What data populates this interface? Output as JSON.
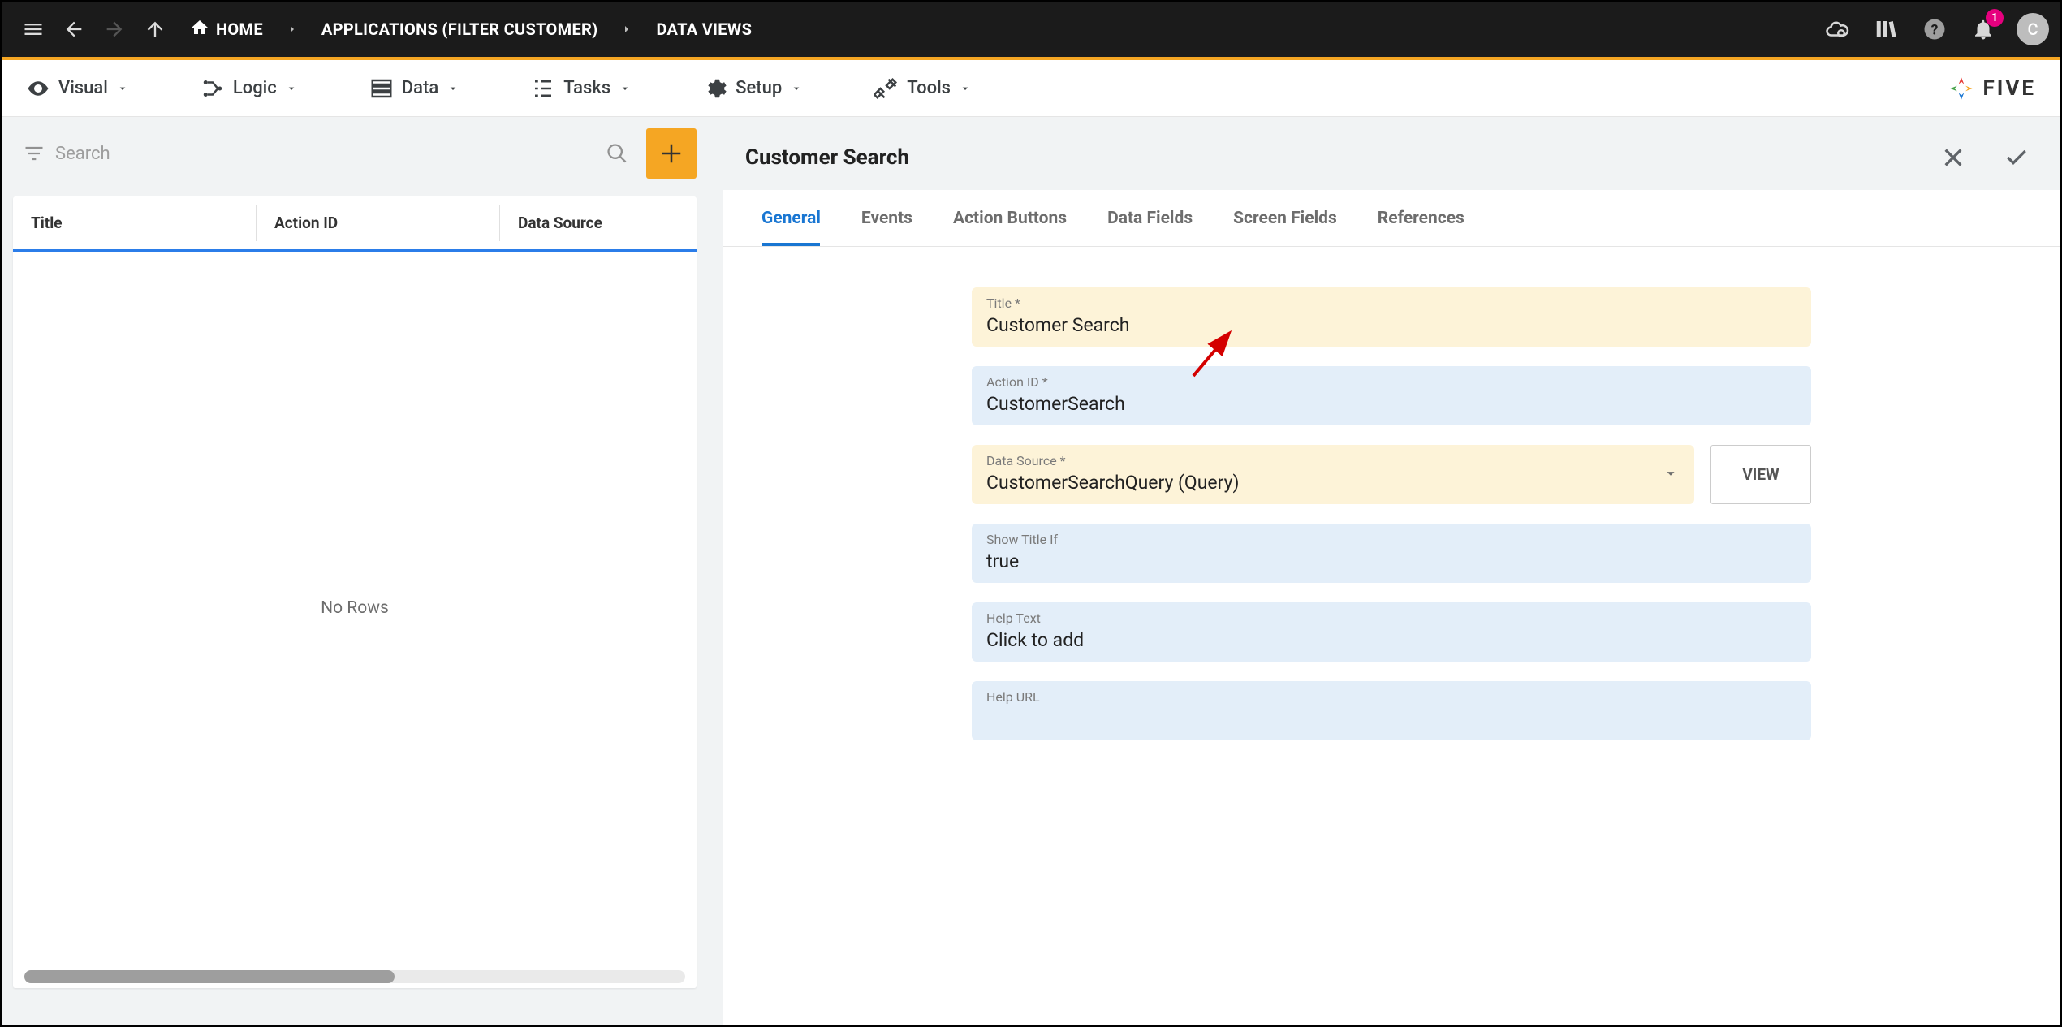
{
  "breadcrumbs": {
    "home": "HOME",
    "apps": "APPLICATIONS (FILTER CUSTOMER)",
    "views": "DATA VIEWS"
  },
  "notifications": {
    "count": "1"
  },
  "avatar_initial": "C",
  "subnav": {
    "visual": "Visual",
    "logic": "Logic",
    "data": "Data",
    "tasks": "Tasks",
    "setup": "Setup",
    "tools": "Tools"
  },
  "brand": "FIVE",
  "left": {
    "search_placeholder": "Search",
    "cols": {
      "title": "Title",
      "action": "Action ID",
      "source": "Data Source"
    },
    "empty": "No Rows"
  },
  "right": {
    "title": "Customer Search",
    "tabs": {
      "general": "General",
      "events": "Events",
      "actions": "Action Buttons",
      "datafields": "Data Fields",
      "screenfields": "Screen Fields",
      "references": "References"
    },
    "view_btn": "VIEW",
    "fields": {
      "title": {
        "label": "Title *",
        "value": "Customer Search"
      },
      "action_id": {
        "label": "Action ID *",
        "value": "CustomerSearch"
      },
      "data_source": {
        "label": "Data Source *",
        "value": "CustomerSearchQuery (Query)"
      },
      "show_title_if": {
        "label": "Show Title If",
        "value": "true"
      },
      "help_text": {
        "label": "Help Text",
        "value": "Click to add"
      },
      "help_url": {
        "label": "Help URL",
        "value": ""
      }
    }
  }
}
